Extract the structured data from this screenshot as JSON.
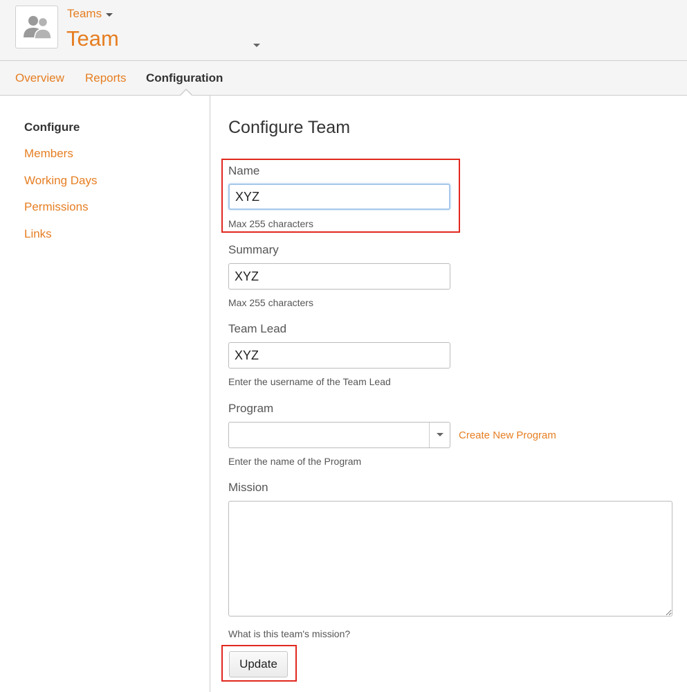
{
  "header": {
    "breadcrumb_label": "Teams",
    "title": "Team",
    "avatar_icon": "team-icon"
  },
  "tabs": [
    {
      "label": "Overview",
      "active": false
    },
    {
      "label": "Reports",
      "active": false
    },
    {
      "label": "Configuration",
      "active": true
    }
  ],
  "sidebar": {
    "items": [
      {
        "label": "Configure",
        "active": true
      },
      {
        "label": "Members",
        "active": false
      },
      {
        "label": "Working Days",
        "active": false
      },
      {
        "label": "Permissions",
        "active": false
      },
      {
        "label": "Links",
        "active": false
      }
    ]
  },
  "form": {
    "title": "Configure Team",
    "name": {
      "label": "Name",
      "value": "XYZ",
      "hint": "Max 255 characters"
    },
    "summary": {
      "label": "Summary",
      "value": "XYZ",
      "hint": "Max 255 characters"
    },
    "team_lead": {
      "label": "Team Lead",
      "value": "XYZ",
      "hint": "Enter the username of the Team Lead"
    },
    "program": {
      "label": "Program",
      "value": "",
      "hint": "Enter the name of the Program",
      "create_link": "Create New Program"
    },
    "mission": {
      "label": "Mission",
      "value": "",
      "hint": "What is this team's mission?"
    },
    "submit_label": "Update"
  },
  "colors": {
    "accent": "#e67e22",
    "highlight": "#e0281e",
    "focus": "#a6c8ea"
  }
}
